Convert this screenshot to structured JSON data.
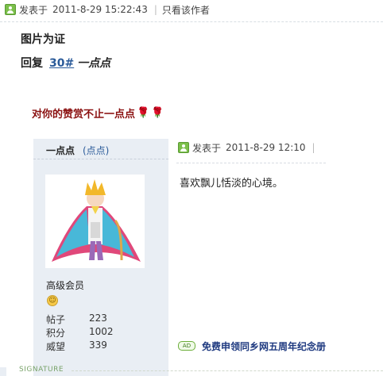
{
  "post": {
    "posted_label": "发表于",
    "timestamp": "2011-8-29 15:22:43",
    "separator": "|",
    "author_only": "只看该作者"
  },
  "title": "图片为证",
  "reply": {
    "prefix": "回复",
    "floor": "30#",
    "quoted_user": "一点点"
  },
  "praise": {
    "text": "对你的赞赏不止一点点",
    "rose": "🌹"
  },
  "card": {
    "username": "一点点",
    "username_alt": "(点点)",
    "rank": "高级会员",
    "stats": [
      {
        "label": "帖子",
        "value": "223"
      },
      {
        "label": "积分",
        "value": "1002"
      },
      {
        "label": "威望",
        "value": "339"
      }
    ]
  },
  "quote": {
    "posted_label": "发表于",
    "timestamp": "2011-8-29 12:10",
    "separator": "|",
    "content": "喜欢飘儿恬淡的心境。",
    "ad_badge": "AD",
    "ad_text": "免费申领同乡网五周年纪念册"
  },
  "signature_label": "SIGNATURE"
}
